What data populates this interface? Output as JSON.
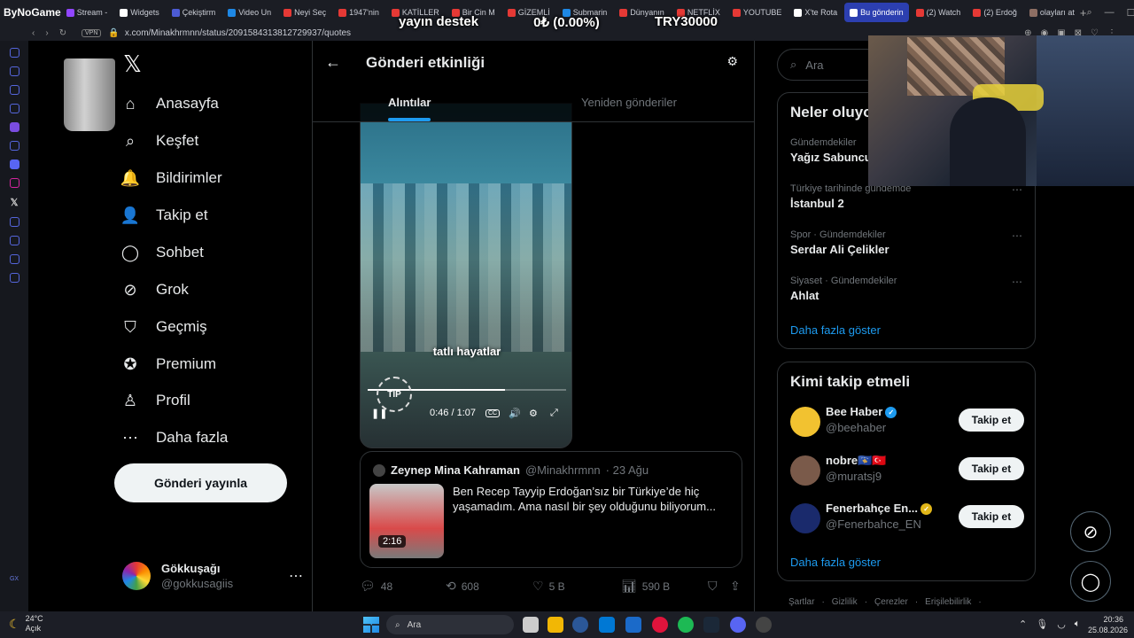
{
  "browser": {
    "logo_text": "ByNoGame",
    "tabs": [
      {
        "label": "Stream -",
        "color": "#9146ff",
        "active": false
      },
      {
        "label": "Widgets",
        "color": "#ffffff",
        "active": false
      },
      {
        "label": "Çekiştirm",
        "color": "#4c5bd4",
        "active": false
      },
      {
        "label": "Video Un",
        "color": "#1e88e5",
        "active": false
      },
      {
        "label": "Neyi Seç",
        "color": "#e53935",
        "active": false
      },
      {
        "label": "1947'nin",
        "color": "#e53935",
        "active": false
      },
      {
        "label": "KATİLLER",
        "color": "#e53935",
        "active": false
      },
      {
        "label": "Bir Cin M",
        "color": "#e53935",
        "active": false
      },
      {
        "label": "GİZEMLİ",
        "color": "#e53935",
        "active": false
      },
      {
        "label": "Submarin",
        "color": "#1e88e5",
        "active": false
      },
      {
        "label": "Dünyanın",
        "color": "#e53935",
        "active": false
      },
      {
        "label": "NETFLİX",
        "color": "#e53935",
        "active": false
      },
      {
        "label": "YOUTUBE",
        "color": "#e53935",
        "active": false
      },
      {
        "label": "X'te Rota",
        "color": "#ffffff",
        "active": false
      },
      {
        "label": "Bu gönderin",
        "color": "#ffffff",
        "active": true
      },
      {
        "label": "(2) Watch",
        "color": "#e53935",
        "active": false
      },
      {
        "label": "(2) Erdoğ",
        "color": "#e53935",
        "active": false
      },
      {
        "label": "olayları at",
        "color": "#8d6e63",
        "active": false
      }
    ],
    "new_tab": "+",
    "address": "x.com/Minakhrmnn/status/2091584313812729937/quotes",
    "vpn_label": "VPN"
  },
  "stream_overlay": {
    "left": "yayın destek",
    "center": "0₺ (0.00%)",
    "right": "TRY30000"
  },
  "nav": {
    "items": [
      {
        "label": "Anasayfa",
        "icon": "home-icon",
        "glyph": "⌂"
      },
      {
        "label": "Keşfet",
        "icon": "search-icon",
        "glyph": "⌕"
      },
      {
        "label": "Bildirimler",
        "icon": "bell-icon",
        "glyph": "🔔"
      },
      {
        "label": "Takip et",
        "icon": "follow-icon",
        "glyph": "👤"
      },
      {
        "label": "Sohbet",
        "icon": "chat-icon",
        "glyph": "◯"
      },
      {
        "label": "Grok",
        "icon": "grok-icon",
        "glyph": "⊘"
      },
      {
        "label": "Geçmiş",
        "icon": "bookmark-icon",
        "glyph": "⛉"
      },
      {
        "label": "Premium",
        "icon": "premium-icon",
        "glyph": "✪"
      },
      {
        "label": "Profil",
        "icon": "profile-icon",
        "glyph": "♙"
      },
      {
        "label": "Daha fazla",
        "icon": "more-icon",
        "glyph": "⋯"
      }
    ],
    "post_button": "Gönderi yayınla",
    "account_name": "Gökkuşağı",
    "account_handle": "@gokkusagiis"
  },
  "main": {
    "title": "Gönderi etkinliği",
    "tabs": [
      "Alıntılar",
      "Yeniden gönderiler"
    ],
    "video": {
      "caption": "tatlı hayatlar",
      "badge": "TİP",
      "time": "0:46 / 1:07",
      "progress": 0.69,
      "cc": "CC"
    },
    "quote": {
      "name": "Zeynep Mina Kahraman",
      "handle": "@Minakhrmnn",
      "date": "· 23 Ağu",
      "text": "Ben Recep Tayyip Erdoğan’sız bir Türkiye’de hiç yaşamadım. Ama nasıl bir şey olduğunu biliyorum...",
      "duration": "2:16"
    },
    "actions": {
      "replies": "48",
      "reposts": "608",
      "likes": "5 B",
      "views": "590 B"
    }
  },
  "right": {
    "search_placeholder": "Ara",
    "trends_title": "Neler oluyor",
    "trends": [
      {
        "category": "Gündemdekiler",
        "title": "Yağız Sabuncu"
      },
      {
        "category": "Türkiye tarihinde gündemde",
        "title": "İstanbul 2"
      },
      {
        "category": "Spor · Gündemdekiler",
        "title": "Serdar Ali Çelikler"
      },
      {
        "category": "Siyaset · Gündemdekiler",
        "title": "Ahlat"
      }
    ],
    "show_more": "Daha fazla göster",
    "who_title": "Kimi takip etmeli",
    "who": [
      {
        "name": "Bee Haber",
        "handle": "@beehaber",
        "color": "#f2c230"
      },
      {
        "name": "nobre🇽🇰🇹🇷",
        "handle": "@muratsj9",
        "color": "#7a5a4a"
      },
      {
        "name": "Fenerbahçe En...",
        "handle": "@Fenerbahce_EN",
        "color": "#1a2a6c"
      }
    ],
    "follow_label": "Takip et",
    "footer": [
      "Şartlar",
      "·",
      "Gizlilik",
      "·",
      "Çerezler",
      "·",
      "Erişilebilirlik",
      "·"
    ]
  },
  "taskbar": {
    "temp": "24°C",
    "weather": "Açık",
    "search": "Ara",
    "time": "20:36",
    "date": "25.08.2026"
  }
}
